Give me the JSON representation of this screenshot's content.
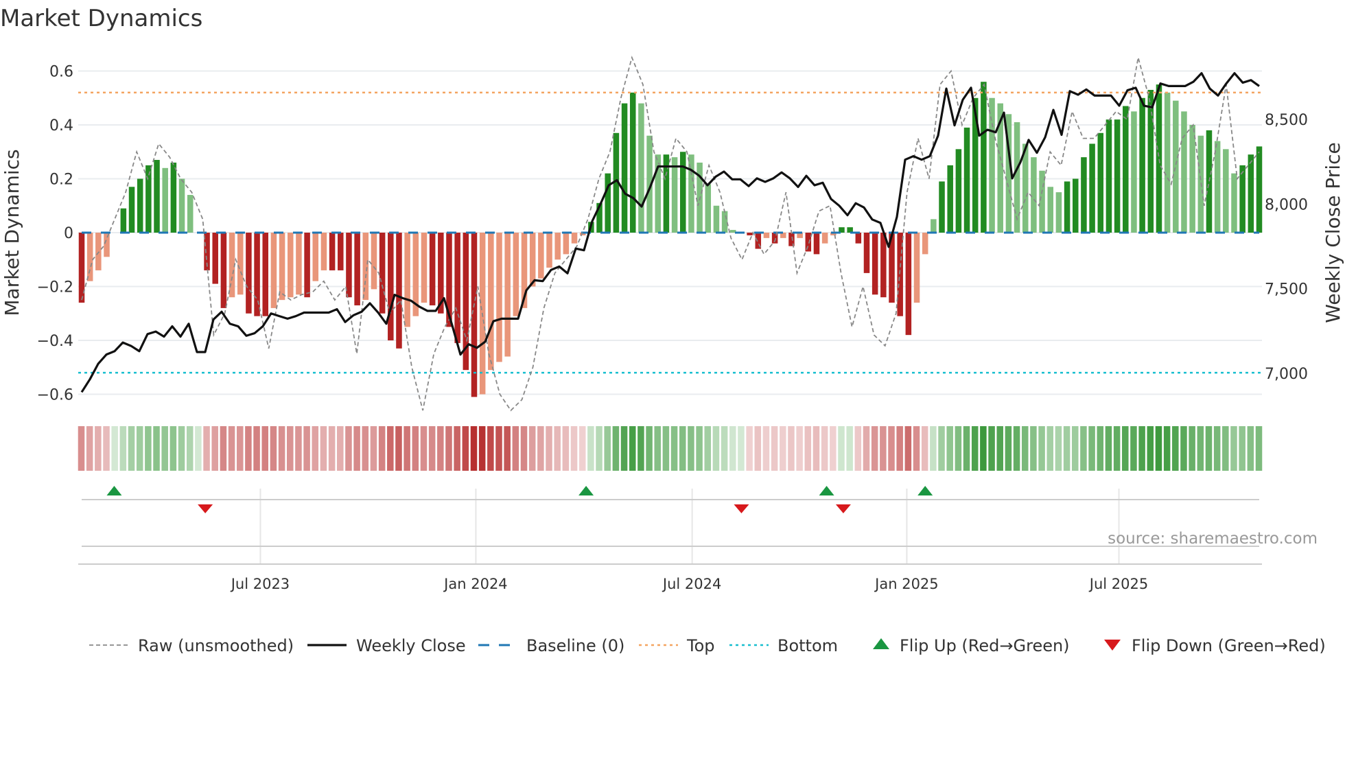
{
  "title": "Market Dynamics",
  "source": "source: sharemaestro.com",
  "colors": {
    "strong_up": "#228b22",
    "weak_up": "#7fbf7f",
    "strong_down": "#b22222",
    "weak_down": "#e9967a",
    "raw": "#888888",
    "close": "#111111",
    "baseline": "#1f77b4",
    "top": "#f4a460",
    "bottom": "#17becf",
    "flip_up": "#1a9641",
    "flip_down": "#d7191c"
  },
  "chart_data": {
    "type": "bar",
    "title": "Market Dynamics",
    "ylabel": "Market Dynamics",
    "ylabel_right": "Weekly Close Price",
    "ylim": [
      -0.67,
      0.67
    ],
    "ylim_right": [
      6830,
      8830
    ],
    "y_ticks": [
      {
        "v": 0.6,
        "label": "0.6"
      },
      {
        "v": 0.4,
        "label": "0.4"
      },
      {
        "v": 0.2,
        "label": "0.2"
      },
      {
        "v": 0,
        "label": "0"
      },
      {
        "v": -0.2,
        "label": "−0.2"
      },
      {
        "v": -0.4,
        "label": "−0.4"
      },
      {
        "v": -0.6,
        "label": "−0.6"
      }
    ],
    "y_ticks_right": [
      {
        "v": 8500,
        "label": "8,500"
      },
      {
        "v": 8000,
        "label": "8,000"
      },
      {
        "v": 7500,
        "label": "7,500"
      },
      {
        "v": 7000,
        "label": "7,000"
      }
    ],
    "x_ticks": [
      {
        "week": 21.4,
        "label": "Jul 2023"
      },
      {
        "week": 47.2,
        "label": "Jan 2024"
      },
      {
        "week": 73.1,
        "label": "Jul 2024"
      },
      {
        "week": 98.8,
        "label": "Jan 2025"
      },
      {
        "week": 124.2,
        "label": "Jul 2025"
      }
    ],
    "baseline": 0,
    "top": 0.52,
    "bottom": -0.52,
    "dynamics": [
      -0.26,
      -0.18,
      -0.14,
      -0.09,
      0.0,
      0.09,
      0.17,
      0.2,
      0.25,
      0.27,
      0.24,
      0.26,
      0.2,
      0.14,
      0.0,
      -0.14,
      -0.19,
      -0.28,
      -0.24,
      -0.23,
      -0.3,
      -0.31,
      -0.31,
      -0.28,
      -0.25,
      -0.24,
      -0.23,
      -0.24,
      -0.18,
      -0.14,
      -0.14,
      -0.14,
      -0.24,
      -0.27,
      -0.25,
      -0.21,
      -0.3,
      -0.4,
      -0.43,
      -0.35,
      -0.31,
      -0.26,
      -0.27,
      -0.3,
      -0.35,
      -0.41,
      -0.51,
      -0.61,
      -0.6,
      -0.51,
      -0.48,
      -0.46,
      -0.31,
      -0.28,
      -0.2,
      -0.17,
      -0.13,
      -0.1,
      -0.08,
      -0.04,
      -0.01,
      0.04,
      0.11,
      0.22,
      0.37,
      0.48,
      0.52,
      0.48,
      0.36,
      0.29,
      0.29,
      0.28,
      0.3,
      0.29,
      0.26,
      0.18,
      0.1,
      0.08,
      0.01,
      0.0,
      -0.01,
      -0.06,
      -0.02,
      -0.04,
      -0.02,
      -0.05,
      -0.02,
      -0.07,
      -0.08,
      -0.04,
      -0.01,
      0.02,
      0.02,
      -0.04,
      -0.15,
      -0.23,
      -0.24,
      -0.26,
      -0.31,
      -0.38,
      -0.26,
      -0.08,
      0.05,
      0.19,
      0.25,
      0.31,
      0.39,
      0.5,
      0.56,
      0.5,
      0.48,
      0.44,
      0.41,
      0.33,
      0.28,
      0.23,
      0.17,
      0.15,
      0.19,
      0.2,
      0.28,
      0.33,
      0.37,
      0.42,
      0.42,
      0.47,
      0.45,
      0.5,
      0.53,
      0.55,
      0.52,
      0.49,
      0.45,
      0.4,
      0.36,
      0.38,
      0.34,
      0.31,
      0.22,
      0.25,
      0.29,
      0.32
    ],
    "raw": [
      -0.25,
      -0.1,
      -0.05,
      0.05,
      0.15,
      0.3,
      0.2,
      0.33,
      0.28,
      0.2,
      0.15,
      0.05,
      -0.38,
      -0.3,
      -0.1,
      -0.2,
      -0.25,
      -0.43,
      -0.22,
      -0.25,
      -0.23,
      -0.22,
      -0.18,
      -0.25,
      -0.2,
      -0.45,
      -0.1,
      -0.15,
      -0.3,
      -0.25,
      -0.5,
      -0.66,
      -0.45,
      -0.35,
      -0.28,
      -0.4,
      -0.2,
      -0.45,
      -0.6,
      -0.66,
      -0.62,
      -0.5,
      -0.28,
      -0.15,
      -0.1,
      -0.05,
      0.05,
      0.2,
      0.3,
      0.5,
      0.65,
      0.55,
      0.3,
      0.2,
      0.35,
      0.3,
      0.1,
      0.25,
      0.15,
      -0.02,
      -0.1,
      0.0,
      -0.08,
      -0.03,
      0.15,
      -0.15,
      -0.05,
      0.08,
      0.1,
      -0.15,
      -0.35,
      -0.2,
      -0.38,
      -0.42,
      -0.3,
      0.15,
      0.35,
      0.2,
      0.55,
      0.6,
      0.4,
      0.5,
      0.55,
      0.35,
      0.2,
      0.05,
      0.15,
      0.1,
      0.3,
      0.25,
      0.45,
      0.35,
      0.35,
      0.4,
      0.45,
      0.42,
      0.65,
      0.5,
      0.25,
      0.18,
      0.35,
      0.4,
      0.1,
      0.3,
      0.55,
      0.2,
      0.25,
      0.3
    ],
    "weekly_close": [
      6889,
      6965,
      7056,
      7111,
      7131,
      7182,
      7162,
      7131,
      7232,
      7247,
      7217,
      7278,
      7217,
      7293,
      7126,
      7126,
      7318,
      7364,
      7293,
      7278,
      7222,
      7237,
      7278,
      7354,
      7338,
      7323,
      7338,
      7359,
      7359,
      7359,
      7359,
      7379,
      7303,
      7343,
      7364,
      7414,
      7359,
      7293,
      7464,
      7444,
      7429,
      7394,
      7369,
      7369,
      7444,
      7283,
      7111,
      7172,
      7151,
      7187,
      7308,
      7323,
      7323,
      7323,
      7490,
      7550,
      7545,
      7611,
      7631,
      7591,
      7737,
      7727,
      7899,
      8000,
      8111,
      8141,
      8061,
      8035,
      7985,
      8096,
      8222,
      8222,
      8222,
      8222,
      8202,
      8167,
      8111,
      8162,
      8192,
      8146,
      8146,
      8106,
      8152,
      8131,
      8152,
      8187,
      8152,
      8101,
      8167,
      8111,
      8126,
      8030,
      7990,
      7934,
      8005,
      7980,
      7909,
      7889,
      7747,
      7924,
      8262,
      8283,
      8262,
      8283,
      8404,
      8682,
      8465,
      8616,
      8687,
      8404,
      8439,
      8424,
      8540,
      8152,
      8247,
      8379,
      8303,
      8394,
      8556,
      8409,
      8667,
      8646,
      8677,
      8641,
      8641,
      8641,
      8581,
      8672,
      8687,
      8581,
      8571,
      8712,
      8697,
      8697,
      8697,
      8722,
      8773,
      8682,
      8641,
      8712,
      8773,
      8717,
      8732,
      8697
    ],
    "flip_up_weeks": [
      3.9,
      60.4,
      89.2,
      101.0
    ],
    "flip_down_weeks": [
      14.8,
      79.0,
      91.2
    ]
  },
  "legend": [
    {
      "label": "Raw (unsmoothed)",
      "kind": "raw"
    },
    {
      "label": "Weekly Close",
      "kind": "close"
    },
    {
      "label": "Baseline (0)",
      "kind": "baseline"
    },
    {
      "label": "Top",
      "kind": "top"
    },
    {
      "label": "Bottom",
      "kind": "bottom"
    },
    {
      "label": "Flip Up (Red→Green)",
      "kind": "flip_up"
    },
    {
      "label": "Flip Down (Green→Red)",
      "kind": "flip_down"
    }
  ]
}
